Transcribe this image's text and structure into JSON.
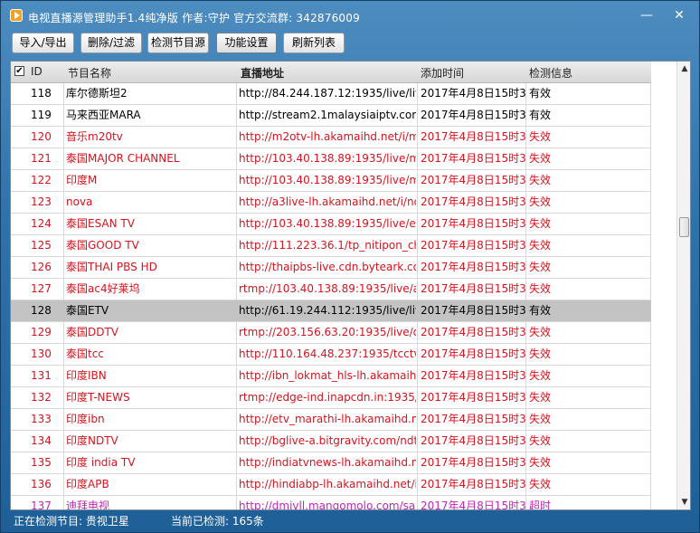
{
  "window": {
    "title": "电视直播源管理助手1.4纯净版  作者:守护   官方交流群: 342876009",
    "minimize_glyph": "—",
    "close_glyph": "✕"
  },
  "toolbar": {
    "buttons": [
      {
        "label": "导入/导出"
      },
      {
        "label": "删除/过滤"
      },
      {
        "label": "检测节目源"
      },
      {
        "label": "功能设置"
      },
      {
        "label": "刷新列表"
      }
    ]
  },
  "table": {
    "select_all_checked": true,
    "columns": [
      "ID",
      "节目名称",
      "直播地址",
      "添加时间",
      "检测信息"
    ],
    "rows": [
      {
        "id": "118",
        "name": "库尔德斯坦2",
        "url": "http://84.244.187.12:1935/live/live",
        "time": "2017年4月8日15时38",
        "status": "有效",
        "state": "ok"
      },
      {
        "id": "119",
        "name": "马来西亚MARA",
        "url": "http://stream2.1malaysiaiptv.com",
        "time": "2017年4月8日15时38",
        "status": "有效",
        "state": "ok"
      },
      {
        "id": "120",
        "name": "音乐m20tv",
        "url": "http://m2otv-lh.akamaihd.net/i/m",
        "time": "2017年4月8日15时38",
        "status": "失效",
        "state": "fail"
      },
      {
        "id": "121",
        "name": "泰国MAJOR CHANNEL",
        "url": "http://103.40.138.89:1935/live/mix",
        "time": "2017年4月8日15时38",
        "status": "失效",
        "state": "fail"
      },
      {
        "id": "122",
        "name": "印度M",
        "url": "http://103.40.138.89:1935/live/mo",
        "time": "2017年4月8日15时38",
        "status": "失效",
        "state": "fail"
      },
      {
        "id": "123",
        "name": "nova",
        "url": "http://a3live-lh.akamaihd.net/i/no",
        "time": "2017年4月8日15时38",
        "status": "失效",
        "state": "fail"
      },
      {
        "id": "124",
        "name": "泰国ESAN TV",
        "url": "http://103.40.138.89:1935/live/esa",
        "time": "2017年4月8日15时38",
        "status": "失效",
        "state": "fail"
      },
      {
        "id": "125",
        "name": "泰国GOOD TV",
        "url": "http://111.223.36.1/tp_nitipon_ch.",
        "time": "2017年4月8日15时38",
        "status": "失效",
        "state": "fail"
      },
      {
        "id": "126",
        "name": "泰国THAI PBS HD",
        "url": "http://thaipbs-live.cdn.byteark.co",
        "time": "2017年4月8日15时38",
        "status": "失效",
        "state": "fail"
      },
      {
        "id": "127",
        "name": "泰国ac4好莱坞",
        "url": "rtmp://103.40.138.89:1935/live/ac",
        "time": "2017年4月8日15时38",
        "status": "失效",
        "state": "fail"
      },
      {
        "id": "128",
        "name": "泰国ETV",
        "url": "http://61.19.244.112:1935/live/live",
        "time": "2017年4月8日15时38",
        "status": "有效",
        "state": "ok",
        "selected": true
      },
      {
        "id": "129",
        "name": "泰国DDTV",
        "url": "rtmp://203.156.63.20:1935/live/dd",
        "time": "2017年4月8日15时38",
        "status": "失效",
        "state": "fail"
      },
      {
        "id": "130",
        "name": "泰国tcc",
        "url": "http://110.164.48.237:1935/tcctv_c",
        "time": "2017年4月8日15时38",
        "status": "失效",
        "state": "fail"
      },
      {
        "id": "131",
        "name": "印度IBN",
        "url": "http://ibn_lokmat_hls-lh.akamaihd",
        "time": "2017年4月8日15时38",
        "status": "失效",
        "state": "fail"
      },
      {
        "id": "132",
        "name": "印度T-NEWS",
        "url": "rtmp://edge-ind.inapcdn.in:1935/",
        "time": "2017年4月8日15时38",
        "status": "失效",
        "state": "fail"
      },
      {
        "id": "133",
        "name": "印度ibn",
        "url": "http://etv_marathi-lh.akamaihd.ne",
        "time": "2017年4月8日15时38",
        "status": "失效",
        "state": "fail"
      },
      {
        "id": "134",
        "name": "印度NDTV",
        "url": "http://bglive-a.bitgravity.com/ndt",
        "time": "2017年4月8日15时38",
        "status": "失效",
        "state": "fail"
      },
      {
        "id": "135",
        "name": "印度 india TV",
        "url": "http://indiatvnews-lh.akamaihd.ne",
        "time": "2017年4月8日15时38",
        "status": "失效",
        "state": "fail"
      },
      {
        "id": "136",
        "name": "印度APB",
        "url": "http://hindiabp-lh.akamaihd.net/i/",
        "time": "2017年4月8日15时38",
        "status": "失效",
        "state": "fail"
      },
      {
        "id": "137",
        "name": "迪拜电视",
        "url": "http://dmivll.mangomolo.com/sar",
        "time": "2017年4月8日15时38",
        "status": "超时",
        "state": "timeout"
      }
    ]
  },
  "scrollbar": {
    "up_glyph": "▲",
    "down_glyph": "▼"
  },
  "statusbar": {
    "checking_label": "正在检测节目: 贵视卫星",
    "checked_count": "当前已检测: 165条"
  },
  "colors": {
    "ok": "#000000",
    "fail": "#d4141e",
    "timeout": "#c026b8",
    "selected_row": "#c3c3c3"
  }
}
